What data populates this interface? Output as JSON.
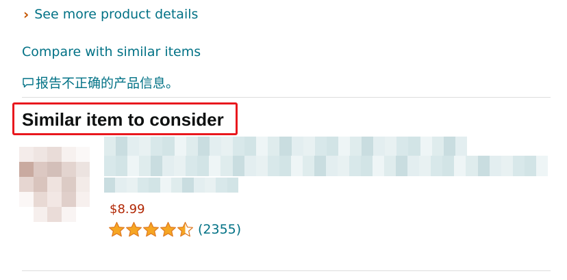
{
  "details": {
    "see_more_label": "See more product details",
    "compare_label": "Compare with similar items",
    "report_label": "报告不正确的产品信息。"
  },
  "section": {
    "title": "Similar item to consider"
  },
  "product": {
    "price": "$8.99",
    "rating": 4.5,
    "max_rating": 5,
    "review_count": "(2355)"
  },
  "colors": {
    "link": "#007185",
    "price": "#b12704",
    "star": "#f6a623",
    "highlight": "#e8171d"
  },
  "icons": {
    "chevron": "chevron-right-icon",
    "report": "speech-bubble-icon",
    "star": "star-icon"
  }
}
